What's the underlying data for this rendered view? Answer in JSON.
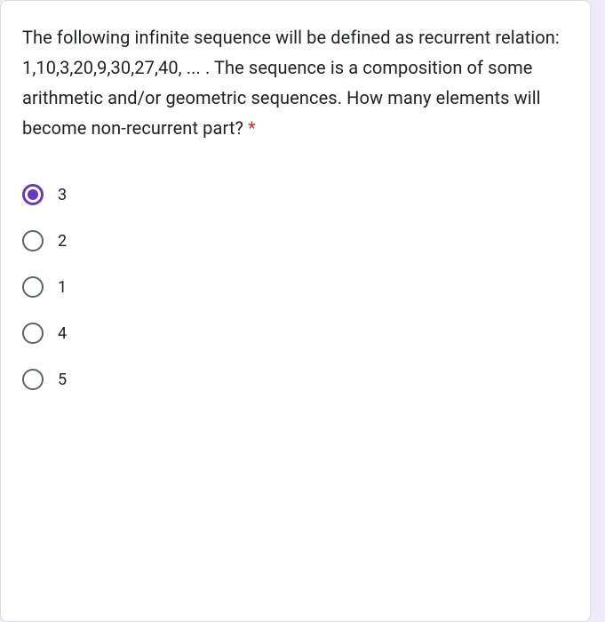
{
  "question": {
    "text": "The following infinite sequence will be defined as recurrent relation: 1,10,3,20,9,30,27,40, ... . The sequence is a composition of some arithmetic and/or geometric sequences. How many elements will become non-recurrent part?",
    "required_marker": "*"
  },
  "options": [
    {
      "label": "3",
      "selected": true
    },
    {
      "label": "2",
      "selected": false
    },
    {
      "label": "1",
      "selected": false
    },
    {
      "label": "4",
      "selected": false
    },
    {
      "label": "5",
      "selected": false
    }
  ]
}
